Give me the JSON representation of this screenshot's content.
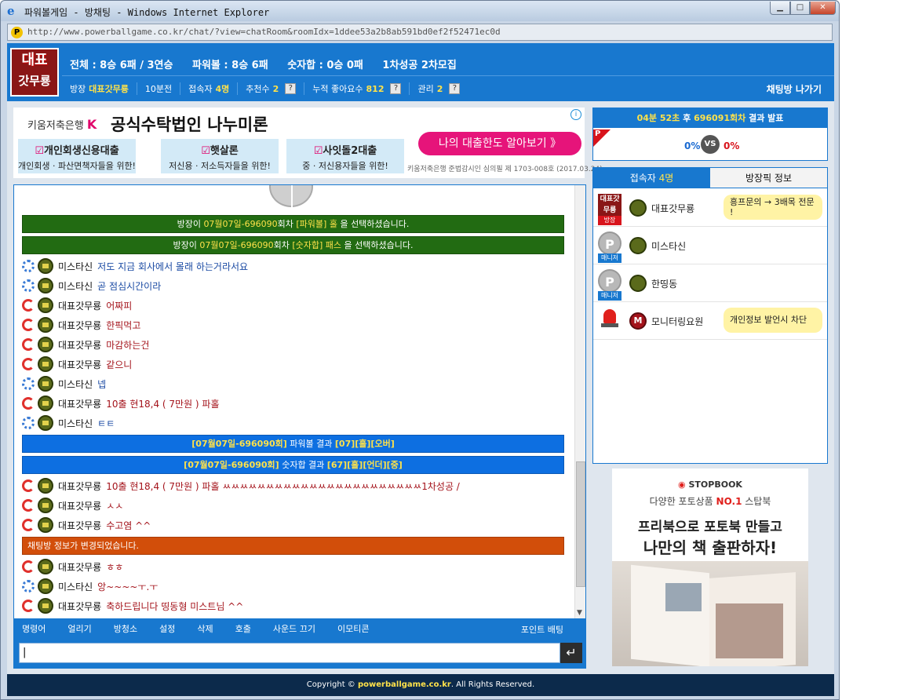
{
  "window": {
    "title": "파워볼게임 - 방채팅 - Windows Internet Explorer",
    "url": "http://www.powerballgame.co.kr/chat/?view=chatRoom&roomIdx=1ddee53a2b8ab591bd0ef2f52471ec0d"
  },
  "header": {
    "logo_line1": "대표",
    "logo_line2": "갓무룡",
    "total": "전체 : 8승 6패 / 3연승",
    "powerball": "파워볼 : 8승 6패",
    "number_sum": "숫자합 : 0승 0패",
    "recruit": "1차성공 2차모집",
    "owner_label": "방장",
    "owner_name": "대표갓무룡",
    "elapsed": "10분전",
    "users_label": "접속자",
    "users_count": "4명",
    "recommend_label": "추천수",
    "recommend_count": "2",
    "likes_label": "누적 좋아요수",
    "likes_count": "812",
    "admin_label": "관리",
    "admin_count": "2",
    "help_btn": "?",
    "exit_label": "채팅방 나가기"
  },
  "ad_top": {
    "bank": "키움저축은행",
    "bank_mark": "K",
    "headline": "공식수탁법인 나누미론",
    "check": "☑",
    "boxes": [
      {
        "title": "개인회생신용대출",
        "sub": "개인회생 · 파산면책자들을 위한!"
      },
      {
        "title": "햇살론",
        "sub": "저신용 · 저소득자들을 위한!"
      },
      {
        "title": "사잇돌2대출",
        "sub": "중 · 저신용자들을 위한!"
      }
    ],
    "cta": "나의 대출한도 알아보기  》",
    "note": "키움저축은행 준법감시인 심의필 제 1703-008호 (2017.03.24)",
    "info_icon": "i"
  },
  "chat": {
    "sys1_pre": "방장이 ",
    "sys1_round": "07월07일-696090",
    "sys1_mid": "회차 ",
    "sys1_pick": "[파워볼] 홀",
    "sys1_post": " 을 선택하셨습니다.",
    "sys2_pre": "방장이 ",
    "sys2_round": "07월07일-696090",
    "sys2_mid": "회차 ",
    "sys2_pick": "[숫자합] 패스",
    "sys2_post": " 을 선택하셨습니다.",
    "messages": [
      {
        "nick": "미스타신",
        "text": "저도 지금 회사에서 몰래 하는거라서요"
      },
      {
        "nick": "미스타신",
        "text": "곧 점심시간이라"
      },
      {
        "nick": "대표갓무룡",
        "text": "어짜피"
      },
      {
        "nick": "대표갓무룡",
        "text": "한픽먹고"
      },
      {
        "nick": "대표갓무룡",
        "text": "마감하는건"
      },
      {
        "nick": "대표갓무룡",
        "text": "같으니"
      },
      {
        "nick": "미스타신",
        "text": "넵"
      },
      {
        "nick": "대표갓무룡",
        "text": " 10출 현18,4 ( 7만원 ) 파홀"
      },
      {
        "nick": "미스타신",
        "text": "ㅌㅌ"
      },
      {
        "nick": "대표갓무룡",
        "text": "10출 현18,4 ( 7만원 ) 파홀 ㅆㅆㅆㅆㅆㅆㅆㅆㅆㅆㅆㅆㅆㅆㅆㅆㅆㅆㅆㅆㅆㅆㅆ1차성공 /"
      },
      {
        "nick": "대표갓무룡",
        "text": "ㅅㅅ"
      },
      {
        "nick": "대표갓무룡",
        "text": "수고염 ^^"
      },
      {
        "nick": "대표갓무룡",
        "text": "ㅎㅎ"
      },
      {
        "nick": "미스타신",
        "text": "앙~~~~ㅜ.ㅜ"
      },
      {
        "nick": "대표갓무룡",
        "text": "축하드립니다 띵동형 미스트님 ^^"
      }
    ],
    "res1_round": "[07월07일-696090회]",
    "res1_label": " 파워볼 결과 ",
    "res1_val": "[07][홀][오버]",
    "res2_round": "[07월07일-696090회]",
    "res2_label": " 숫자합 결과 ",
    "res2_val": "[67][홀][언더][중]",
    "info_changed": "채팅방 정보가 변경되었습니다.",
    "menu": [
      "명령어",
      "얼리기",
      "방청소",
      "설정",
      "삭제",
      "호출",
      "사운드 끄기",
      "이모티콘"
    ],
    "point_bet": "포인트 배팅",
    "input_value": "|",
    "send_icon": "↵"
  },
  "result": {
    "time": "04분 52초",
    "mid": " 후 ",
    "round": "696091회차",
    "post": " 결과 발표",
    "p_mark": "P",
    "left_pct": "0%",
    "vs": "VS",
    "right_pct": "0%"
  },
  "users": {
    "tab_users_label": "접속자 ",
    "tab_users_count": "4명",
    "tab_info": "방장픽 정보",
    "list": [
      {
        "name": "대표갓무룡",
        "badge": "방장",
        "bubble": "흥프문의 → 3배목 전문 !",
        "avatar": "대표갓무룡"
      },
      {
        "name": "미스타신",
        "badge": "매니저",
        "avatar": "P"
      },
      {
        "name": "한띵동",
        "badge": "매니저",
        "avatar": "P"
      },
      {
        "name": "모니터링요원",
        "bubble": "개인정보 발언시 차단",
        "rank": "M"
      }
    ]
  },
  "ad_right": {
    "brand": "STOPBOOK",
    "tag_pre": "다양한 포토상품 ",
    "tag_no1": "NO.1",
    "tag_post": " 스탑북",
    "h1": "프리북으로 포토북 만들고",
    "h2": "나만의 책 출판하자!"
  },
  "footer": {
    "pre": "Copyright © ",
    "site": "powerballgame.co.kr",
    "post": ". All Rights Reserved."
  },
  "colors": {
    "header_blue": "#1878cf",
    "green_notice": "#226b12",
    "blue_result": "#0d6fe1",
    "orange_info": "#d24e0a",
    "footer_navy": "#0c2a4b"
  }
}
